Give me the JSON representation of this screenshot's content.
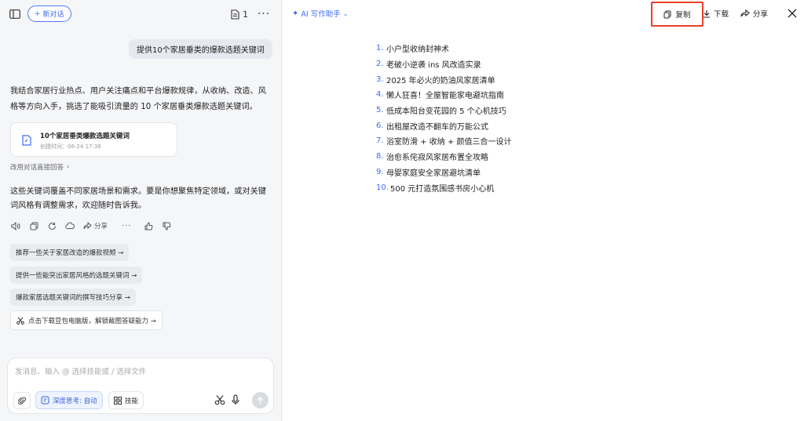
{
  "topbar": {
    "new_chat_label": "新对话",
    "doc_count": "1"
  },
  "chat": {
    "user_message": "提供10个家居垂类的爆款选题关键词",
    "reply_intro": "我结合家居行业热点、用户关注痛点和平台爆款规律，从收纳、改造、风格等方向入手，挑选了能吸引流量的 10 个家居垂类爆款选题关键词。",
    "file_card": {
      "title": "10个家居垂类爆款选题关键词",
      "created": "创建时间：06-24 17:38"
    },
    "change_reply_label": "改用对话直接回答",
    "reply_outro": "这些关键词覆盖不同家居场景和需求。要是你想聚焦特定领域，或对关键词风格有调整需求，欢迎随时告诉我。",
    "share_label": "分享",
    "suggestions": [
      "推荐一些关于家居改造的爆款视频 →",
      "提供一些能突出家居风格的选题关键词 →",
      "爆款家居选题关键词的撰写技巧分享 →"
    ],
    "pc_promo": "点击下载豆包电脑版，解锁截图答疑能力 →"
  },
  "input": {
    "placeholder": "发消息、输入 @ 选择技能或 / 选择文件",
    "deep_think_label": "深度思考: 自动",
    "skills_label": "技能"
  },
  "doc": {
    "assistant_label": "AI 写作助手",
    "copy_label": "复制",
    "download_label": "下载",
    "share_label": "分享",
    "items": [
      {
        "num": "1.",
        "text": "小户型收纳封神术"
      },
      {
        "num": "2.",
        "text": "老破小逆袭 ins 风改造实录"
      },
      {
        "num": "3.",
        "text": "2025 年必火的奶油风家居清单"
      },
      {
        "num": "4.",
        "text": "懒人狂喜！全屋智能家电避坑指南"
      },
      {
        "num": "5.",
        "text": "低成本阳台变花园的 5 个心机技巧"
      },
      {
        "num": "6.",
        "text": "出租屋改造不翻车的万能公式"
      },
      {
        "num": "7.",
        "text": "浴室防滑 + 收纳 + 颜值三合一设计"
      },
      {
        "num": "8.",
        "text": "治愈系侘寂风家居布置全攻略"
      },
      {
        "num": "9.",
        "text": "母婴家庭安全家居避坑清单"
      },
      {
        "num": "10.",
        "text": "500 元打造氛围感书房小心机"
      }
    ]
  },
  "colors": {
    "accent": "#3d6ef2",
    "highlight_box": "#e8412f"
  }
}
